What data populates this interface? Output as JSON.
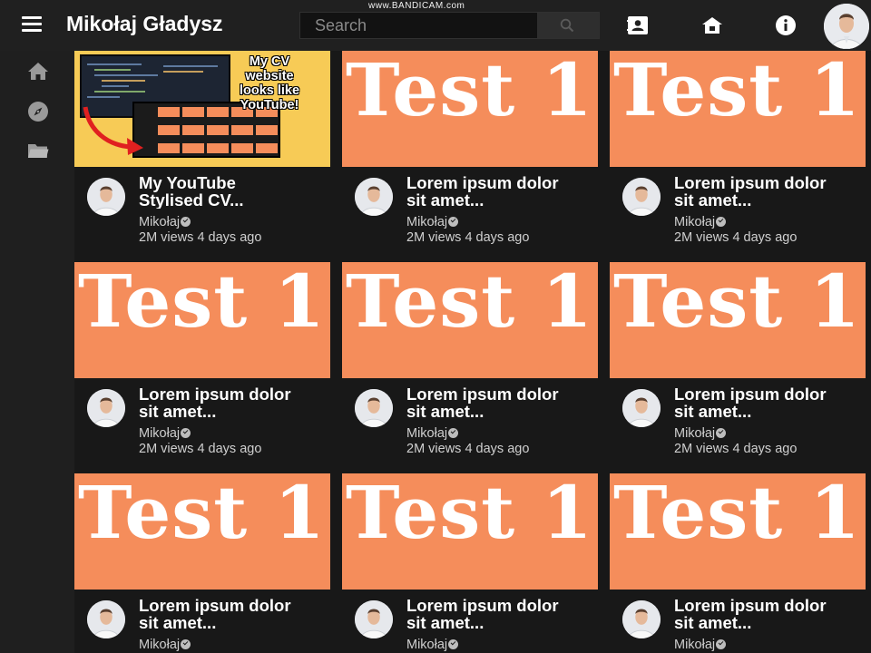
{
  "header": {
    "title": "Mikołaj Gładysz",
    "watermark": "www.BANDICAM.com",
    "search_placeholder": "Search",
    "icons": [
      "menu-icon",
      "search-icon",
      "contact-card-icon",
      "school-icon",
      "info-icon"
    ]
  },
  "sidebar": {
    "icons": [
      "home-icon",
      "explore-icon",
      "folder-icon"
    ]
  },
  "theme": {
    "background": "#181818",
    "topbar": "#202020",
    "thumbnail": "#f58d5b",
    "cv_thumbnail": "#f7cb56"
  },
  "cards": [
    {
      "thumb_text": "My CV website looks like YouTube!",
      "title": "My YouTube\nStylised CV...",
      "channel": "Mikołaj",
      "meta": "2M views 4 days ago"
    },
    {
      "thumb_text": "Test 1",
      "title": "Lorem ipsum dolor\nsit amet...",
      "channel": "Mikołaj",
      "meta": "2M views 4 days ago"
    },
    {
      "thumb_text": "Test 1",
      "title": "Lorem ipsum dolor\nsit amet...",
      "channel": "Mikołaj",
      "meta": "2M views 4 days ago"
    },
    {
      "thumb_text": "Test 1",
      "title": "Lorem ipsum dolor\nsit amet...",
      "channel": "Mikołaj",
      "meta": "2M views 4 days ago"
    },
    {
      "thumb_text": "Test 1",
      "title": "Lorem ipsum dolor\nsit amet...",
      "channel": "Mikołaj",
      "meta": "2M views 4 days ago"
    },
    {
      "thumb_text": "Test 1",
      "title": "Lorem ipsum dolor\nsit amet...",
      "channel": "Mikołaj",
      "meta": "2M views 4 days ago"
    },
    {
      "thumb_text": "Test 1",
      "title": "Lorem ipsum dolor\nsit amet...",
      "channel": "Mikołaj",
      "meta": ""
    },
    {
      "thumb_text": "Test 1",
      "title": "Lorem ipsum dolor\nsit amet...",
      "channel": "Mikołaj",
      "meta": ""
    },
    {
      "thumb_text": "Test 1",
      "title": "Lorem ipsum dolor\nsit amet...",
      "channel": "Mikołaj",
      "meta": ""
    }
  ]
}
